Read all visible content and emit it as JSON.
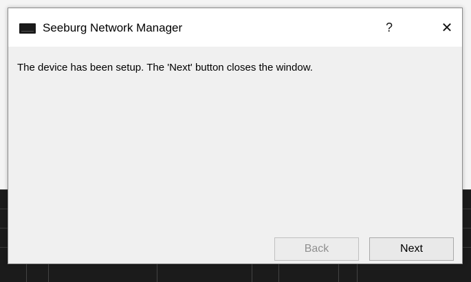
{
  "window": {
    "title": "Seeburg Network Manager",
    "help_label": "?",
    "close_label": "✕"
  },
  "content": {
    "message": "The device has been setup. The 'Next' button closes the window."
  },
  "footer": {
    "back_label": "Back",
    "next_label": "Next"
  }
}
